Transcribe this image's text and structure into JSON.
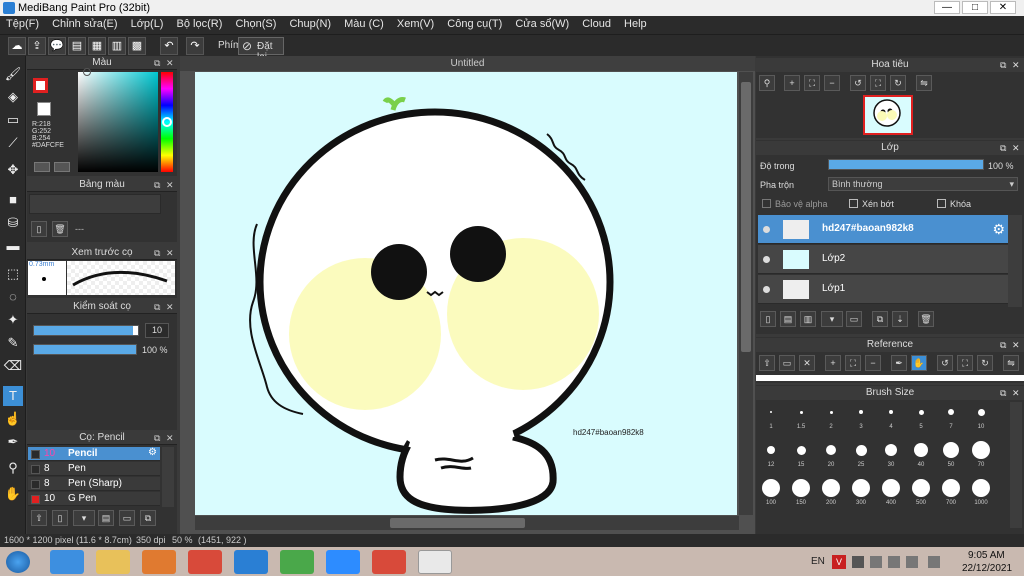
{
  "window": {
    "title": "MediBang Paint Pro (32bit)",
    "min": "—",
    "max": "□",
    "close": "✕"
  },
  "menu": [
    "Tệp(F)",
    "Chỉnh sửa(E)",
    "Lớp(L)",
    "Bộ lọc(R)",
    "Chọn(S)",
    "Chup(N)",
    "Màu (C)",
    "Xem(V)",
    "Công cụ(T)",
    "Cửa sổ(W)",
    "Cloud",
    "Help"
  ],
  "toolbar": {
    "phim_label": "Phím",
    "reset_label": "Đặt lại"
  },
  "color_panel": {
    "title": "Màu",
    "r": "R:218",
    "g": "G:252",
    "b": "B:254",
    "hex": "#DAFCFE",
    "fg_color": "#e02020",
    "bg_color": "#ffffff"
  },
  "swatch_panel": {
    "title": "Bảng màu",
    "dash": "---"
  },
  "brush_preview": {
    "title": "Xem trước cọ",
    "size": "0.73mm"
  },
  "brush_control": {
    "title": "Kiểm soát cọ",
    "size_value": "10",
    "opacity_value": "100 %",
    "size_fraction": 0.95,
    "opacity_fraction": 1.0
  },
  "brush_list": {
    "title": "Cọ: Pencil",
    "items": [
      {
        "size": "10",
        "name": "Pencil",
        "selected": true,
        "color": "#2a2a2a"
      },
      {
        "size": "8",
        "name": "Pen",
        "selected": false,
        "color": "#2a2a2a"
      },
      {
        "size": "8",
        "name": "Pen (Sharp)",
        "selected": false,
        "color": "#2a2a2a"
      },
      {
        "size": "10",
        "name": "G Pen",
        "selected": false,
        "color": "#e02020"
      }
    ]
  },
  "canvas": {
    "tab": "Untitled",
    "watermark": "hd247#baoan982k8",
    "bg_color": "#d9fcfe"
  },
  "navigator": {
    "title": "Hoa tiêu"
  },
  "layer_panel": {
    "title": "Lớp",
    "opacity_label": "Độ trong",
    "opacity_value": "100 %",
    "opacity_fraction": 1.0,
    "blend_label": "Pha trộn",
    "blend_value": "Bình thường",
    "protect_alpha": "Bảo vệ alpha",
    "clip": "Xén bớt",
    "lock": "Khóa",
    "layers": [
      {
        "name": "hd247#baoan982k8",
        "selected": true
      },
      {
        "name": "Lớp2",
        "selected": false
      },
      {
        "name": "Lớp1",
        "selected": false
      }
    ]
  },
  "reference": {
    "title": "Reference"
  },
  "brush_size": {
    "title": "Brush Size",
    "sizes": [
      "1",
      "1.5",
      "2",
      "3",
      "4",
      "5",
      "7",
      "10",
      "12",
      "15",
      "20",
      "25",
      "30",
      "40",
      "50",
      "70",
      "100",
      "150",
      "200",
      "300",
      "400",
      "500",
      "700",
      "1000"
    ]
  },
  "status": {
    "dimensions": "1600 * 1200 pixel",
    "size_cm": "(11.6 * 8.7cm)",
    "dpi": "350 dpi",
    "zoom": "50 %",
    "coords": "(1451, 922 )"
  },
  "taskbar": {
    "lang": "EN",
    "time": "9:05 AM",
    "date": "22/12/2021"
  }
}
